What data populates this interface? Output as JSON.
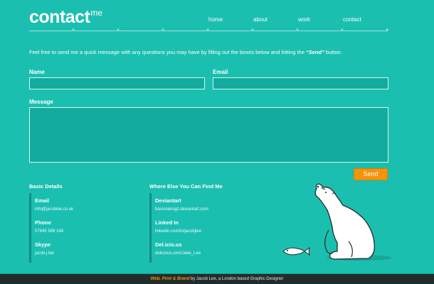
{
  "logo": {
    "main": "contact",
    "sup": "me"
  },
  "nav": [
    "home",
    "about",
    "work",
    "contact"
  ],
  "intro": {
    "before": "Feel free to send me a quick message with any questions you may have by filling out the boxes below and hitting the ",
    "emphasis": "“Send”",
    "after": " button."
  },
  "form": {
    "name_label": "Name",
    "email_label": "Email",
    "message_label": "Message",
    "send_label": "Send"
  },
  "basic": {
    "title": "Basic Details",
    "items": [
      {
        "label": "Email",
        "value": "info@jacoblee.co.uk"
      },
      {
        "label": "Phone",
        "value": "07845 589 184"
      },
      {
        "label": "Skype",
        "value": "jacob.j.lee"
      }
    ]
  },
  "elsewhere": {
    "title": "Where Else You Can Find Me",
    "items": [
      {
        "label": "Deviantart",
        "value": "bassmansgz.deviantart.com"
      },
      {
        "label": "Linked In",
        "value": "linkedin.com/in/jacobjlee"
      },
      {
        "label": "Del.icio.us",
        "value": "delicious.com/Jake_Lee"
      }
    ]
  },
  "footer": {
    "accent": "Web, Print & Brand",
    "rest": " by Jacob Lee, a London based Graphic Designer"
  },
  "colors": {
    "background": "#1bbfb0",
    "field": "#13ab9d",
    "accent": "#f7930a",
    "footer": "#212c2b"
  },
  "icons": {
    "illustration": "polar-bear-with-fish"
  }
}
